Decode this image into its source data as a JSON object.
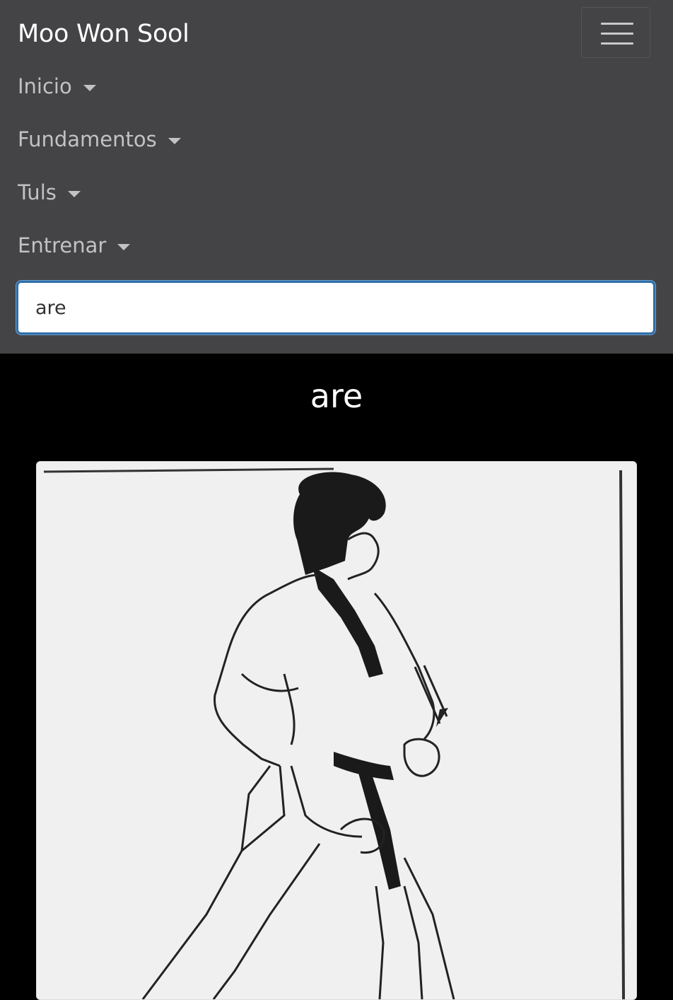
{
  "navbar": {
    "brand": "Moo Won Sool",
    "toggler_icon": "hamburger-menu-icon",
    "items": [
      {
        "label": "Inicio"
      },
      {
        "label": "Fundamentos"
      },
      {
        "label": "Tuls"
      },
      {
        "label": "Entrenar"
      }
    ],
    "search": {
      "value": "are",
      "placeholder": ""
    }
  },
  "result": {
    "title": "are",
    "image_alt": "martial-arts-stance-illustration"
  },
  "colors": {
    "navbar_bg": "#444446",
    "page_bg": "#000000",
    "search_border": "#2f6ea7",
    "nav_text": "#c2c2c2"
  }
}
